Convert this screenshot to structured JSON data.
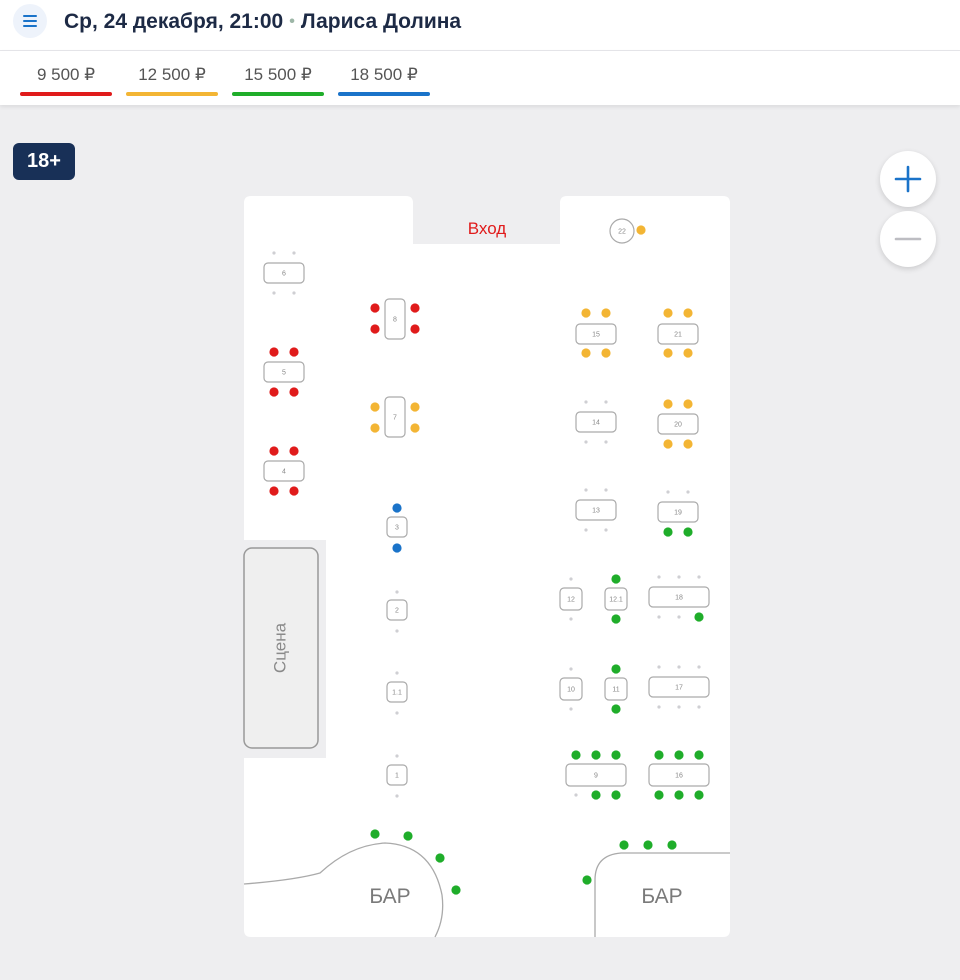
{
  "header": {
    "date_time": "Ср, 24 декабря, 21:00",
    "separator": "•",
    "performer": "Лариса Долина"
  },
  "prices": [
    {
      "label": "9 500 ₽",
      "color": "#e01b1b"
    },
    {
      "label": "12 500 ₽",
      "color": "#f3b534"
    },
    {
      "label": "15 500 ₽",
      "color": "#1fad2a"
    },
    {
      "label": "18 500 ₽",
      "color": "#1a73c9"
    }
  ],
  "age_badge": "18+",
  "map_labels": {
    "entrance": "Вход",
    "stage": "Сцена",
    "bar_left": "БАР",
    "bar_right": "БАР"
  },
  "tables": [
    {
      "num": "6",
      "price": null
    },
    {
      "num": "5",
      "price": "9 500 ₽",
      "seats_available": 4
    },
    {
      "num": "4",
      "price": "9 500 ₽",
      "seats_available": 4
    },
    {
      "num": "8",
      "price": "9 500 ₽",
      "seats_available": 4
    },
    {
      "num": "7",
      "price": "12 500 ₽",
      "seats_available": 4
    },
    {
      "num": "3",
      "price": "18 500 ₽",
      "seats_available": 2
    },
    {
      "num": "2",
      "price": null
    },
    {
      "num": "1.1",
      "price": null
    },
    {
      "num": "1",
      "price": null
    },
    {
      "num": "22",
      "price": "12 500 ₽",
      "seats_available": 1
    },
    {
      "num": "15",
      "price": "12 500 ₽",
      "seats_available": 4
    },
    {
      "num": "21",
      "price": "12 500 ₽",
      "seats_available": 4
    },
    {
      "num": "14",
      "price": null
    },
    {
      "num": "20",
      "price": "12 500 ₽",
      "seats_available": 4
    },
    {
      "num": "13",
      "price": null
    },
    {
      "num": "19",
      "price": "15 500 ₽",
      "seats_available": 2
    },
    {
      "num": "12",
      "price": null
    },
    {
      "num": "12.1",
      "price": "15 500 ₽",
      "seats_available": 2
    },
    {
      "num": "18",
      "price": "15 500 ₽",
      "seats_available": 1
    },
    {
      "num": "10",
      "price": null
    },
    {
      "num": "11",
      "price": "15 500 ₽",
      "seats_available": 2
    },
    {
      "num": "17",
      "price": null
    },
    {
      "num": "9",
      "price": "15 500 ₽",
      "seats_available": 5
    },
    {
      "num": "16",
      "price": "15 500 ₽",
      "seats_available": 6
    }
  ],
  "bar_seats": {
    "left_available": 4,
    "right_available": 4,
    "price": "15 500 ₽"
  },
  "icons": {
    "menu": "hamburger-icon",
    "zoom_in": "plus-icon",
    "zoom_out": "minus-icon"
  }
}
